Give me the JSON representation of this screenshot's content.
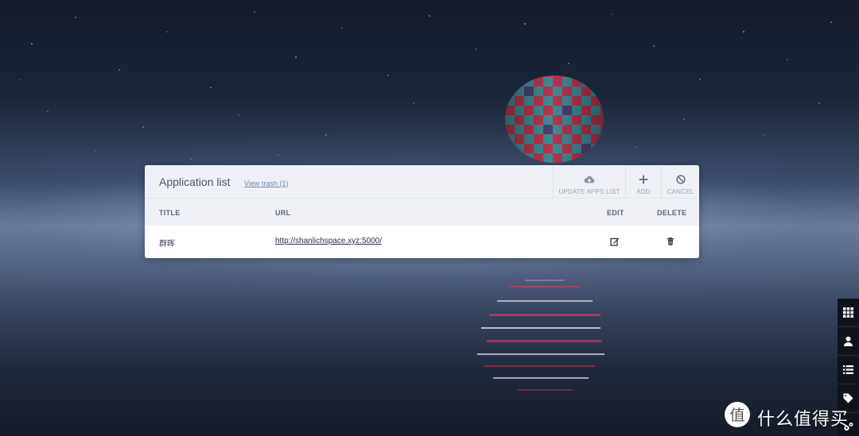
{
  "card": {
    "title": "Application list",
    "trash_link": "View trash (1)",
    "actions": {
      "update": "UPDATE APPS LIST",
      "add": "ADD",
      "cancel": "CANCEL"
    },
    "columns": {
      "title": "TITLE",
      "url": "URL",
      "edit": "EDIT",
      "delete": "DELETE"
    },
    "rows": [
      {
        "title": "群晖",
        "url": "http://shanlichspace.xyz:5000/"
      }
    ]
  },
  "sidebar": {
    "icons": [
      "grid-icon",
      "user-icon",
      "list-icon",
      "tag-icon",
      "cogs-icon"
    ]
  },
  "watermark": {
    "text": "什么值得买",
    "logo_char": "值"
  },
  "colors": {
    "header_bg": "#eff1f6",
    "link": "#6f86a8",
    "sidebar_bg": "#0e131b"
  }
}
